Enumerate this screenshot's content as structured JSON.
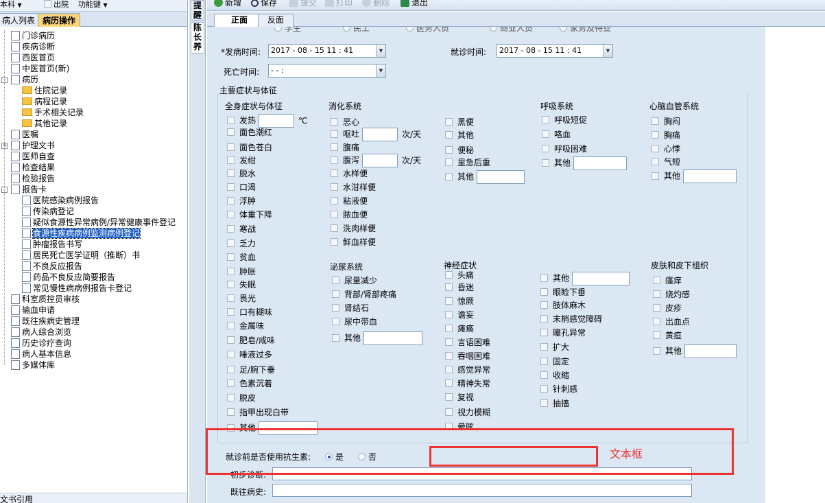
{
  "left": {
    "dropdown1": "本科",
    "dropdown2": "出院",
    "dropdown3": "功能键",
    "tabs": [
      "病人列表",
      "病历操作"
    ],
    "tree": [
      {
        "label": "门诊病历"
      },
      {
        "label": "疾病诊断"
      },
      {
        "label": "西医首页"
      },
      {
        "label": "中医首页(新)"
      },
      {
        "label": "病历"
      },
      {
        "label": "住院记录"
      },
      {
        "label": "病程记录"
      },
      {
        "label": "手术相关记录"
      },
      {
        "label": "其他记录"
      },
      {
        "label": "医嘱"
      },
      {
        "label": "护理文书"
      },
      {
        "label": "医师自查"
      },
      {
        "label": "检查结果"
      },
      {
        "label": "检验报告"
      },
      {
        "label": "报告卡"
      },
      {
        "label": "医院感染病例报告"
      },
      {
        "label": "传染病登记"
      },
      {
        "label": "疑似食源性异常病例/异常健康事件登记"
      },
      {
        "label": "食源性疾病病例监测病例登记"
      },
      {
        "label": "肿瘤报告书写"
      },
      {
        "label": "居民死亡医学证明（推断）书"
      },
      {
        "label": "不良反应报告"
      },
      {
        "label": "药品不良反应简要报告"
      },
      {
        "label": "常见慢性病病例报告卡登记"
      },
      {
        "label": "科室质控员审核"
      },
      {
        "label": "输血申请"
      },
      {
        "label": "既往疾病史管理"
      },
      {
        "label": "病人综合浏览"
      },
      {
        "label": "历史诊疗查询"
      },
      {
        "label": "病人基本信息"
      },
      {
        "label": "多媒体库"
      }
    ],
    "bottom": "文书引用"
  },
  "vtabs": [
    "提醒",
    "陈长养"
  ],
  "toolbar": [
    "新增",
    "保存",
    "提交",
    "打印",
    "删除",
    "退出"
  ],
  "form_tabs": [
    "正面",
    "反面"
  ],
  "form": {
    "top_partial": [
      "学生",
      "民工",
      "医务人员",
      "商业人员",
      "家务及待业"
    ],
    "onset_label": "*发病时间:",
    "onset_value": "2017 - 08 - 15    11 : 41",
    "visit_label": "就诊时间:",
    "visit_value": "2017 - 08 - 15    11 : 41",
    "death_label": "死亡时间:",
    "death_value": "-    -                :",
    "section": "主要症状与体征",
    "groups": {
      "g1": {
        "title": "全身症状与体征",
        "items": [
          "发热",
          "面色潮红",
          "面色苍白",
          "发绀",
          "脱水",
          "口渴",
          "浮肿",
          "体重下降",
          "寒战",
          "乏力",
          "贫血",
          "肿胀",
          "失眠",
          "畏光",
          "口有糊味",
          "金属味",
          "肥皂/咸味",
          "唾液过多",
          "足/腕下垂",
          "色素沉着",
          "脱皮",
          "指甲出现白带",
          "其他"
        ],
        "unit": "℃"
      },
      "g2": {
        "title": "消化系统",
        "items": [
          "恶心",
          "呕吐",
          "腹痛",
          "腹泻",
          "水样便",
          "水泔样便",
          "粘液便",
          "脓血便",
          "洗肉样便",
          "鲜血样便"
        ],
        "unit": "次/天"
      },
      "g3": {
        "items": [
          "黑便",
          "其他",
          "便秘",
          "里急后重",
          "其他"
        ]
      },
      "g4": {
        "title": "呼吸系统",
        "items": [
          "呼吸短促",
          "咯血",
          "呼吸困难",
          "其他"
        ]
      },
      "g5": {
        "title": "心脑血管系统",
        "items": [
          "胸闷",
          "胸痛",
          "心悸",
          "气短",
          "其他"
        ]
      },
      "g6": {
        "title": "泌尿系统",
        "items": [
          "尿量减少",
          "背部/肾部疼痛",
          "肾结石",
          "尿中带血",
          "其他"
        ]
      },
      "g7": {
        "title": "神经症状",
        "items": [
          "头痛",
          "昏迷",
          "惊厥",
          "谵妄",
          "瘫痪",
          "言语困难",
          "吞咽困难",
          "感觉异常",
          "精神失常",
          "复视",
          "视力模糊",
          "晕眩"
        ]
      },
      "g8": {
        "items": [
          "其他",
          "眼睑下垂",
          "肢体麻木",
          "末梢感觉障碍",
          "瞳孔异常",
          "扩大",
          "固定",
          "收缩",
          "针刺感",
          "抽搐"
        ]
      },
      "g9": {
        "title": "皮肤和皮下组织",
        "items": [
          "瘙痒",
          "烧灼感",
          "皮疹",
          "出血点",
          "黄疸",
          "其他"
        ]
      }
    },
    "antibiotic_label": "就诊前是否使用抗生素:",
    "yes": "是",
    "no": "否",
    "annotation": "文本框",
    "prelim_label": "初步诊断:",
    "history_label": "既往病史:"
  }
}
